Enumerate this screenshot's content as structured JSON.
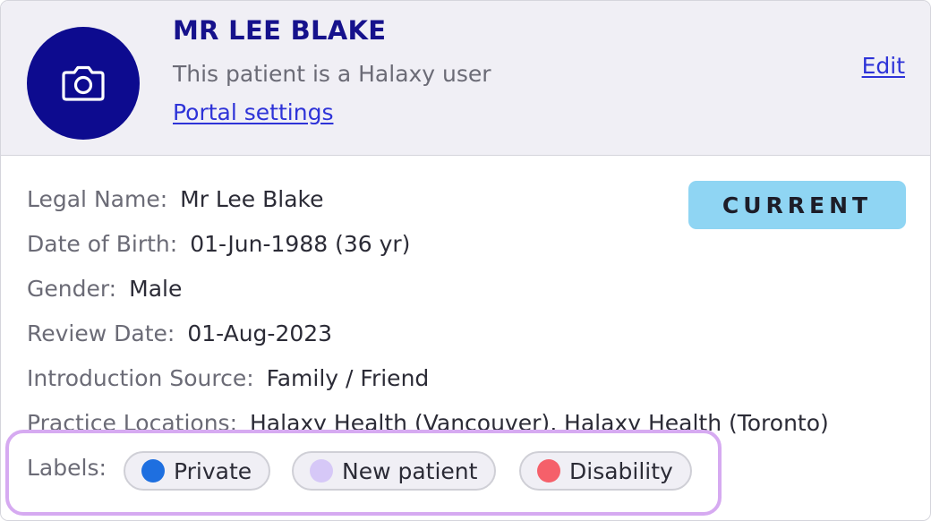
{
  "patient": {
    "name": "MR LEE BLAKE",
    "user_status": "This patient is a Halaxy user",
    "portal_link": "Portal settings",
    "edit_label": "Edit",
    "status_badge": "CURRENT"
  },
  "details": {
    "legal_name": {
      "label": "Legal Name:",
      "value": "Mr Lee Blake"
    },
    "dob": {
      "label": "Date of Birth:",
      "value": "01-Jun-1988 (36 yr)"
    },
    "gender": {
      "label": "Gender:",
      "value": "Male"
    },
    "review_date": {
      "label": "Review Date:",
      "value": "01-Aug-2023"
    },
    "introduction_source": {
      "label": "Introduction Source:",
      "value": "Family / Friend"
    },
    "practice_locations": {
      "label": "Practice Locations:",
      "value": "Halaxy Health (Vancouver),  Halaxy Health (Toronto)"
    }
  },
  "labels": {
    "caption": "Labels:",
    "items": [
      {
        "text": "Private",
        "color": "#1e6fe0"
      },
      {
        "text": "New patient",
        "color": "#d6c8f7"
      },
      {
        "text": "Disability",
        "color": "#f5606a"
      }
    ]
  },
  "icons": {
    "avatar": "camera-icon"
  },
  "colors": {
    "header_bg": "#f0eff5",
    "avatar_bg": "#0d0b8f",
    "name_text": "#16128c",
    "link": "#2e33d8",
    "badge_bg": "#8fd5f3",
    "labels_highlight": "#d6aaf1"
  }
}
